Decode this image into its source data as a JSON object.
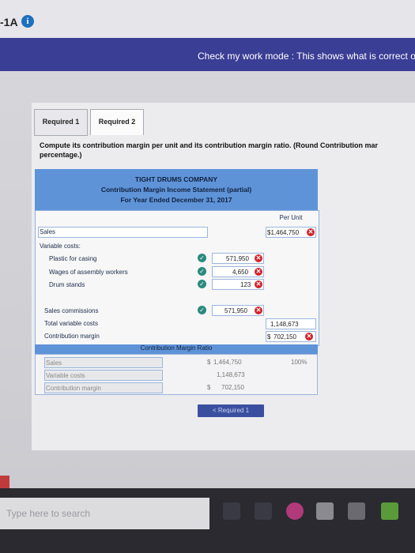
{
  "window": {
    "title": "-1A",
    "info_icon_glyph": "i"
  },
  "banner": {
    "text": "Check my work mode : This shows what is correct or"
  },
  "tabs": [
    {
      "label": "Required 1"
    },
    {
      "label": "Required 2"
    }
  ],
  "instructions": {
    "text": "Compute its contribution margin per unit and its contribution margin ratio. (Round Contribution mar",
    "text2": "percentage.)"
  },
  "statement": {
    "company": "TIGHT DRUMS COMPANY",
    "title": "Contribution Margin Income Statement (partial)",
    "period": "For Year Ended December 31, 2017",
    "per_unit_header": "Per Unit",
    "sales_label": "Sales",
    "sales_value": "$1,464,750",
    "variable_costs_label": "Variable costs:",
    "plastic_label": "Plastic for casing",
    "plastic_value": "571,950",
    "wages_label": "Wages of assembly workers",
    "wages_value": "4,650",
    "drum_label": "Drum stands",
    "drum_value": "123",
    "commissions_label": "Sales commissions",
    "commissions_value": "571,950",
    "total_var_label": "Total variable costs",
    "total_var_value": "1,148,673",
    "cm_label": "Contribution margin",
    "cm_dollar": "$",
    "cm_value": "702,150"
  },
  "ratio": {
    "header": "Contribution Margin Ratio",
    "sales_label": "Sales",
    "sales_dollar": "$",
    "sales_value": "1,464,750",
    "sales_pct": "100%",
    "var_label": "Variable costs",
    "var_value": "1,148,673",
    "cm_label": "Contribution margin",
    "cm_dollar": "$",
    "cm_value": "702,150"
  },
  "nav": {
    "prev_label": "< Required 1"
  },
  "taskbar": {
    "search_placeholder": "Type here to search"
  },
  "colors": {
    "banner": "#3b3e95",
    "header": "#5f93d8",
    "error": "#d1232a",
    "check": "#2a8a7d"
  }
}
